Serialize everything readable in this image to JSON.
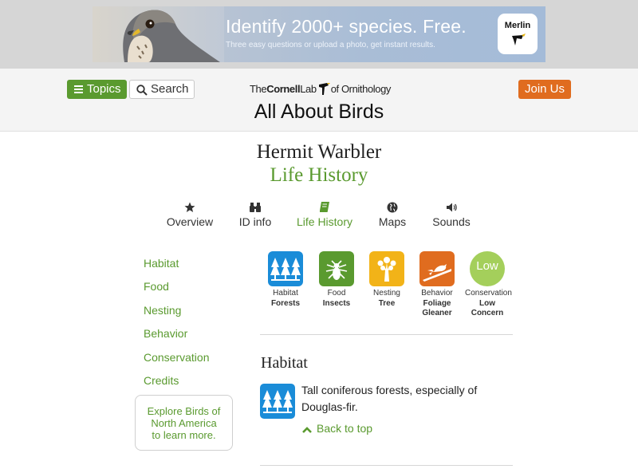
{
  "ad": {
    "headline": "Identify 2000+ species. Free.",
    "subline": "Three easy questions or upload a photo, get instant results.",
    "logo_text": "Merlin"
  },
  "header": {
    "topics_label": "Topics",
    "search_label": "Search",
    "lab_logo": {
      "pre": "The",
      "bold": "Cornell",
      "mid": "Lab",
      "post": "of Ornithology"
    },
    "site_title": "All About Birds",
    "join_label": "Join Us"
  },
  "species": {
    "name": "Hermit Warbler",
    "section": "Life History"
  },
  "tabs": [
    {
      "label": "Overview",
      "icon": "star-icon"
    },
    {
      "label": "ID info",
      "icon": "binoculars-icon"
    },
    {
      "label": "Life History",
      "icon": "book-icon",
      "active": true
    },
    {
      "label": "Maps",
      "icon": "globe-icon"
    },
    {
      "label": "Sounds",
      "icon": "speaker-icon"
    }
  ],
  "sidebar": {
    "links": [
      "Habitat",
      "Food",
      "Nesting",
      "Behavior",
      "Conservation",
      "Credits"
    ],
    "explore_lines": [
      "Explore Birds of",
      "North America",
      "to learn more."
    ]
  },
  "tiles": [
    {
      "caption": "Habitat",
      "value": "Forests",
      "color": "#1a8cd8",
      "icon": "forest-icon"
    },
    {
      "caption": "Food",
      "value": "Insects",
      "color": "#5a9a2f",
      "icon": "insect-icon"
    },
    {
      "caption": "Nesting",
      "value": "Tree",
      "color": "#f2b318",
      "icon": "tree-icon"
    },
    {
      "caption": "Behavior",
      "value": "Foliage Gleaner",
      "value_lines": [
        "Foliage",
        "Gleaner"
      ],
      "color": "#e06c1f",
      "icon": "bird-on-branch-icon"
    },
    {
      "caption": "Conservation",
      "value": "Low Concern",
      "value_lines": [
        "Low",
        "Concern"
      ],
      "badge": "Low",
      "color": "#a4cf5b",
      "icon": "low-concern-badge"
    }
  ],
  "habitat": {
    "heading": "Habitat",
    "text": "Tall coniferous forests, especially of Douglas-fir.",
    "back_to_top": "Back to top"
  }
}
